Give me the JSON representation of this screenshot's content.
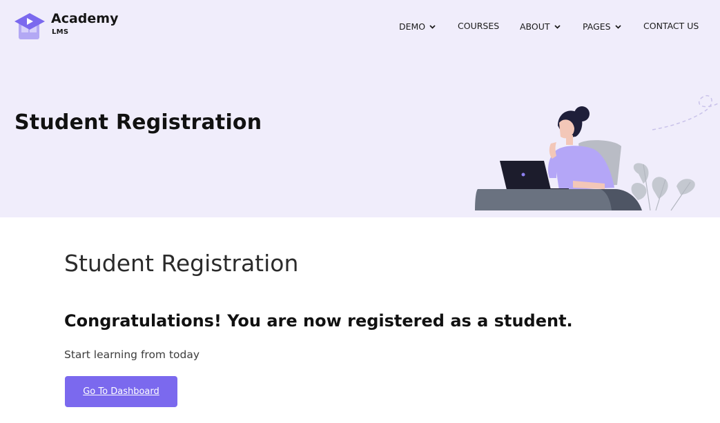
{
  "header": {
    "logo": {
      "name": "Academy",
      "sub": "LMS",
      "icon": "graduation-cap-play-icon"
    },
    "nav": [
      {
        "label": "DEMO",
        "has_dropdown": true
      },
      {
        "label": "COURSES",
        "has_dropdown": false
      },
      {
        "label": "ABOUT",
        "has_dropdown": true
      },
      {
        "label": "PAGES",
        "has_dropdown": true
      },
      {
        "label": "CONTACT US",
        "has_dropdown": false
      }
    ]
  },
  "hero": {
    "title": "Student Registration",
    "illustration": "woman-with-laptop-illustration"
  },
  "main": {
    "title": "Student Registration",
    "congrats": "Congratulations! You are now registered as a student.",
    "subtext": "Start learning from today",
    "button_label": "Go To Dashboard"
  },
  "colors": {
    "hero_bg": "#f0edfb",
    "accent": "#7b69ee",
    "text": "#111111"
  }
}
